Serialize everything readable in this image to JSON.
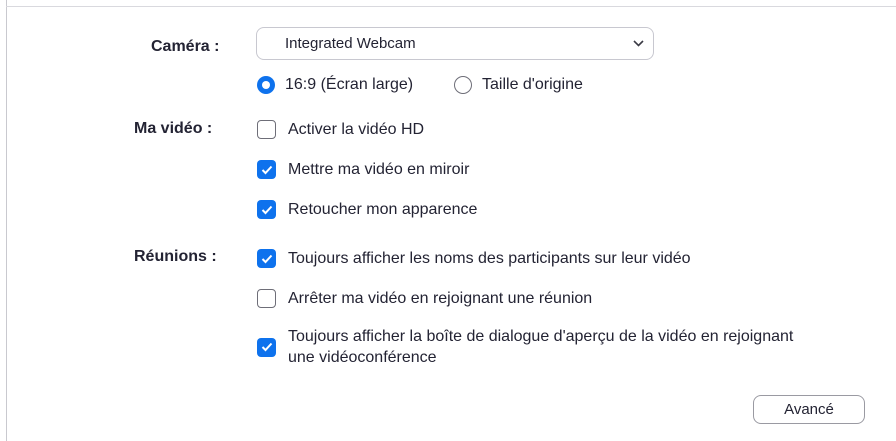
{
  "camera": {
    "label": "Caméra :",
    "selected": "Integrated Webcam",
    "aspect_options": [
      {
        "label": "16:9 (Écran large)",
        "checked": true
      },
      {
        "label": "Taille d'origine",
        "checked": false
      }
    ]
  },
  "my_video": {
    "label": "Ma vidéo :",
    "options": [
      {
        "label": "Activer la vidéo HD",
        "checked": false
      },
      {
        "label": "Mettre ma vidéo en miroir",
        "checked": true
      },
      {
        "label": "Retoucher mon apparence",
        "checked": true
      }
    ]
  },
  "meetings": {
    "label": "Réunions :",
    "options": [
      {
        "label": "Toujours afficher les noms des participants sur leur vidéo",
        "checked": true
      },
      {
        "label": "Arrêter ma vidéo en rejoignant une réunion",
        "checked": false
      },
      {
        "label_line1": "Toujours afficher la boîte de dialogue d'aperçu de la vidéo en rejoignant",
        "label_line2": "une vidéoconférence",
        "checked": true
      }
    ]
  },
  "advanced_button": "Avancé",
  "colors": {
    "accent": "#0e72ed",
    "text": "#232333",
    "border": "#c8c8d0"
  }
}
